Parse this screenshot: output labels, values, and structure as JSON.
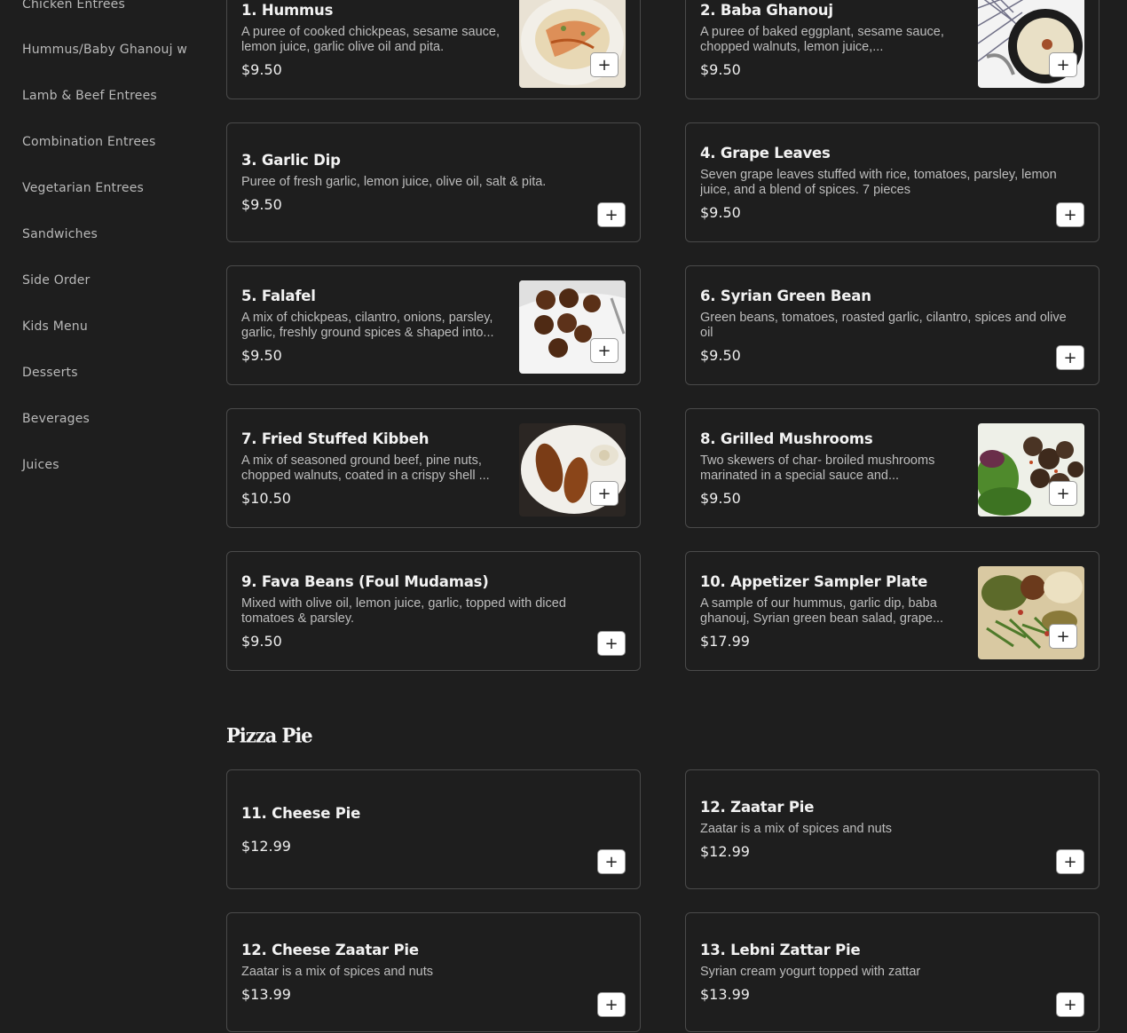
{
  "sidebar": {
    "categories": [
      "Chicken Entrees",
      "Hummus/Baby Ghanouj w",
      "Lamb & Beef Entrees",
      "Combination Entrees",
      "Vegetarian Entrees",
      "Sandwiches",
      "Side Order",
      "Kids Menu",
      "Desserts",
      "Beverages",
      "Juices"
    ]
  },
  "add_button_label": "+",
  "items": [
    {
      "name": "1. Hummus",
      "desc": "A puree of cooked chickpeas, sesame sauce, lemon juice, garlic olive oil and pita.",
      "price": "$9.50"
    },
    {
      "name": "2. Baba Ghanouj",
      "desc": "A puree of baked eggplant, sesame sauce, chopped walnuts, lemon juice,...",
      "price": "$9.50"
    },
    {
      "name": "3. Garlic Dip",
      "desc": "Puree of fresh garlic, lemon juice, olive oil, salt & pita.",
      "price": "$9.50"
    },
    {
      "name": "4. Grape Leaves",
      "desc": "Seven grape leaves stuffed with rice, tomatoes, parsley, lemon juice, and a blend of spices. 7 pieces",
      "price": "$9.50"
    },
    {
      "name": "5. Falafel",
      "desc": "A mix of chickpeas, cilantro, onions, parsley, garlic, freshly ground spices & shaped into...",
      "price": "$9.50"
    },
    {
      "name": "6. Syrian Green Bean",
      "desc": "Green beans, tomatoes, roasted garlic, cilantro, spices and olive oil",
      "price": "$9.50"
    },
    {
      "name": "7. Fried Stuffed Kibbeh",
      "desc": "A mix of seasoned ground beef, pine nuts, chopped walnuts, coated in a crispy shell ...",
      "price": "$10.50"
    },
    {
      "name": "8. Grilled Mushrooms",
      "desc": "Two skewers of char- broiled mushrooms marinated in a special sauce and...",
      "price": "$9.50"
    },
    {
      "name": "9. Fava Beans (Foul Mudamas)",
      "desc": "Mixed with olive oil, lemon juice, garlic, topped with diced tomatoes & parsley.",
      "price": "$9.50"
    },
    {
      "name": "10. Appetizer Sampler Plate",
      "desc": "A sample of our hummus, garlic dip, baba ghanouj, Syrian green bean salad, grape...",
      "price": "$17.99"
    }
  ],
  "pizza_section": {
    "title": "Pizza Pie",
    "items": [
      {
        "name": "11. Cheese Pie",
        "price": "$12.99"
      },
      {
        "name": "12. Zaatar Pie",
        "desc": "Zaatar is a mix of spices and nuts",
        "price": "$12.99"
      },
      {
        "name": "12. Cheese Zaatar Pie",
        "desc": "Zaatar is a mix of spices and nuts",
        "price": "$13.99"
      },
      {
        "name": "13. Lebni Zattar Pie",
        "desc": "Syrian cream yogurt topped with zattar",
        "price": "$13.99"
      }
    ]
  }
}
